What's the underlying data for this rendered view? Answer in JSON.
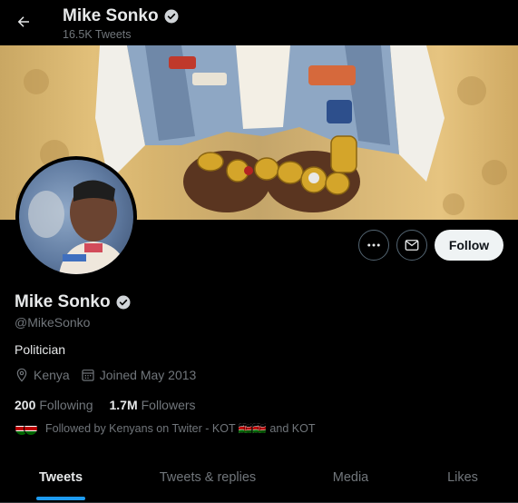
{
  "header": {
    "name": "Mike Sonko",
    "tweet_count": "16.5K Tweets"
  },
  "profile": {
    "name": "Mike Sonko",
    "handle": "@MikeSonko",
    "bio": "Politician",
    "location": "Kenya",
    "joined": "Joined May 2013",
    "following_count": "200",
    "following_label": "Following",
    "followers_count": "1.7M",
    "followers_label": "Followers",
    "followed_by": "Followed by Kenyans on Twiter - KOT 🇰🇪🇰🇪 and KOT"
  },
  "actions": {
    "follow_label": "Follow"
  },
  "tabs": [
    {
      "label": "Tweets",
      "active": true
    },
    {
      "label": "Tweets & replies",
      "active": false
    },
    {
      "label": "Media",
      "active": false
    },
    {
      "label": "Likes",
      "active": false
    }
  ],
  "colors": {
    "accent": "#1d9bf0",
    "background": "#000000",
    "muted_text": "#71767b",
    "verified_badge": "#e7e9ea"
  },
  "icons": {
    "back": "arrow-left-icon",
    "verified": "verified-badge-icon",
    "more": "more-horizontal-icon",
    "message": "envelope-icon",
    "location": "location-pin-icon",
    "calendar": "calendar-icon"
  }
}
